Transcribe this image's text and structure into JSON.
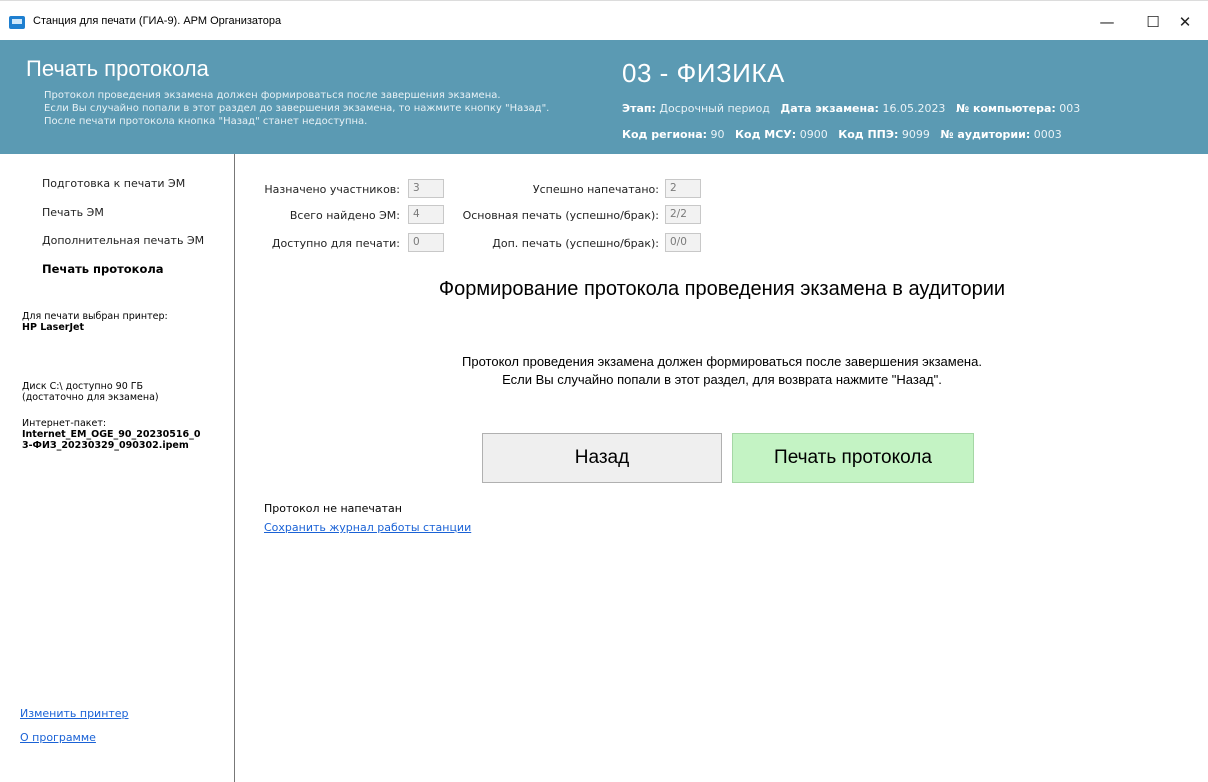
{
  "window": {
    "title": "Станция для печати (ГИА-9). АРМ Организатора",
    "minimize": "—",
    "maximize": "☐",
    "close": "✕"
  },
  "header": {
    "title": "Печать протокола",
    "desc_line1": "Протокол проведения экзамена должен формироваться после завершения экзамена.",
    "desc_line2": "Если Вы случайно попали в этот раздел до завершения экзамена, то нажмите кнопку \"Назад\".",
    "desc_line3": "После печати протокола кнопка \"Назад\" станет недоступна.",
    "subject": "03 - ФИЗИКА",
    "stage_label": "Этап:",
    "stage_value": "Досрочный период",
    "exam_date_label": "Дата экзамена:",
    "exam_date_value": "16.05.2023",
    "computer_label": "№ компьютера:",
    "computer_value": "003",
    "region_label": "Код региона:",
    "region_value": "90",
    "msu_label": "Код МСУ:",
    "msu_value": "0900",
    "ppe_label": "Код ППЭ:",
    "ppe_value": "9099",
    "auditorium_label": "№ аудитории:",
    "auditorium_value": "0003"
  },
  "sidebar": {
    "items": [
      {
        "label": "Подготовка к печати ЭМ"
      },
      {
        "label": "Печать ЭМ"
      },
      {
        "label": "Дополнительная печать ЭМ"
      },
      {
        "label": "Печать протокола"
      }
    ],
    "printer_label": "Для печати выбран принтер:",
    "printer_name": "HP LaserJet",
    "disk_line1": "Диск C:\\ доступно 90 ГБ",
    "disk_line2": "(достаточно для экзамена)",
    "package_label": "Интернет-пакет:",
    "package_line1": "Internet_EM_OGE_90_20230516_0",
    "package_line2": "3-ФИЗ_20230329_090302.ipem",
    "change_printer": "Изменить принтер",
    "about": "О программе"
  },
  "stats": {
    "assigned_label": "Назначено участников:",
    "assigned_value": "3",
    "found_label": "Всего найдено ЭМ:",
    "found_value": "4",
    "available_label": "Доступно для печати:",
    "available_value": "0",
    "printed_label": "Успешно напечатано:",
    "printed_value": "2",
    "main_print_label": "Основная печать (успешно/брак):",
    "main_print_value": "2/2",
    "extra_print_label": "Доп. печать (успешно/брак):",
    "extra_print_value": "0/0"
  },
  "main": {
    "heading": "Формирование протокола проведения экзамена в аудитории",
    "info_line1": "Протокол проведения экзамена должен формироваться после завершения экзамена.",
    "info_line2": "Если Вы случайно попали в этот раздел, для возврата нажмите \"Назад\".",
    "back_button": "Назад",
    "print_button": "Печать протокола",
    "status": "Протокол не напечатан",
    "save_journal": "Сохранить журнал работы станции"
  },
  "colors": {
    "header_bg": "#5b9ab3",
    "print_button_bg": "#c4f3c4",
    "link": "#1a62d6"
  }
}
